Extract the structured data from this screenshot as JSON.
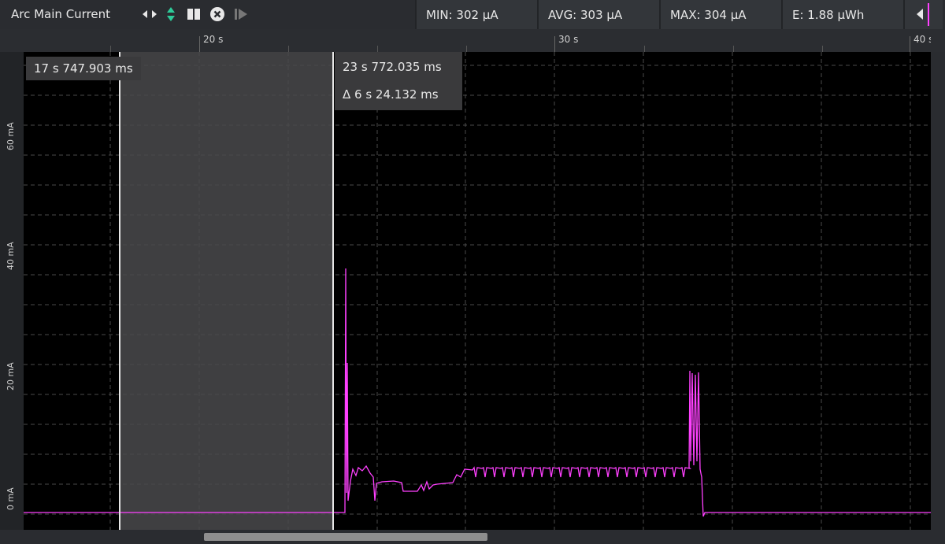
{
  "header": {
    "title": "Arc Main Current",
    "icons": [
      "pan-horizontal-icon",
      "zoom-vertical-icon",
      "stop-icon",
      "clear-icon",
      "play-icon"
    ]
  },
  "stats": [
    {
      "key": "min",
      "label": "MIN: 302 µA"
    },
    {
      "key": "avg",
      "label": "AVG: 303 µA"
    },
    {
      "key": "max",
      "label": "MAX: 304 µA"
    },
    {
      "key": "energy",
      "label": "E: 1.88 µWh"
    }
  ],
  "ruler": {
    "labels": [
      "20 s",
      "30 s",
      "40 s"
    ]
  },
  "yaxis": {
    "labels": [
      "60 mA",
      "40 mA",
      "20 mA",
      "0 mA"
    ]
  },
  "cursors": {
    "a_time": "17 s 747.903 ms",
    "b_time": "23 s 772.035 ms",
    "delta": "Δ 6 s 24.132 ms"
  },
  "colors": {
    "trace": "#ff40ff",
    "background": "#000000",
    "selection": "#3f3f41",
    "accent": "#ff40ff"
  }
}
